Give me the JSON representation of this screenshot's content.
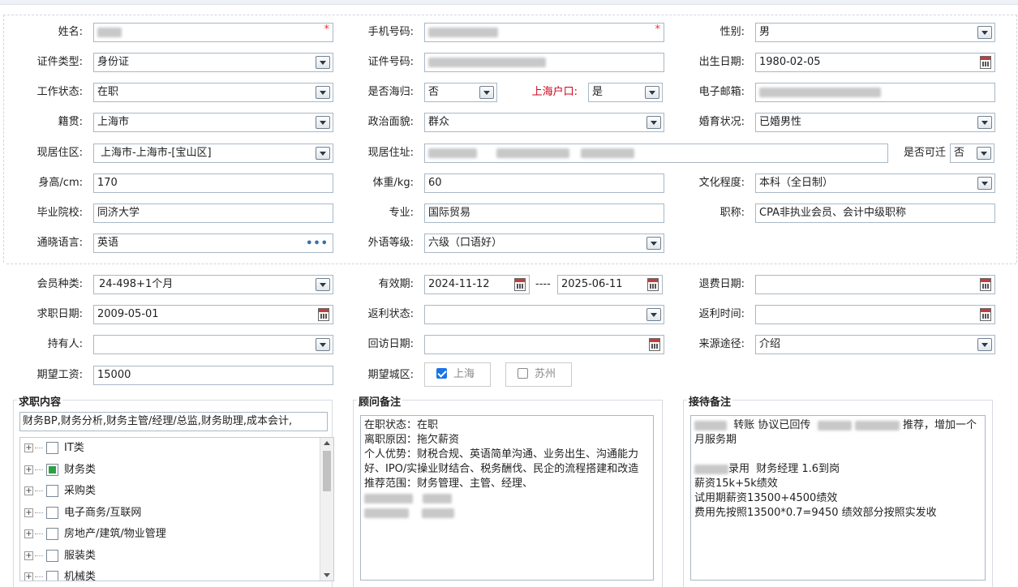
{
  "section1": {
    "name": {
      "label": "姓名:"
    },
    "phone": {
      "label": "手机号码:"
    },
    "gender": {
      "label": "性别:",
      "value": "男"
    },
    "id_type": {
      "label": "证件类型:",
      "value": "身份证"
    },
    "id_number": {
      "label": "证件号码:"
    },
    "birthday": {
      "label": "出生日期:",
      "value": "1980-02-05"
    },
    "work_status": {
      "label": "工作状态:",
      "value": "在职"
    },
    "returnee": {
      "label": "是否海归:",
      "value": "否"
    },
    "shanghai_hukou": {
      "label": "上海户口:",
      "value": "是"
    },
    "email": {
      "label": "电子邮箱:"
    },
    "native_place": {
      "label": "籍贯:",
      "value": "上海市"
    },
    "political": {
      "label": "政治面貌:",
      "value": "群众"
    },
    "marital": {
      "label": "婚育状况:",
      "value": "已婚男性"
    },
    "residence_area": {
      "label": "现居住区:",
      "value": "上海市-上海市-[宝山区]"
    },
    "residence_address": {
      "label": "现居住址:"
    },
    "relocate": {
      "label": "是否可迁",
      "value": "否"
    },
    "height": {
      "label": "身高/cm:",
      "value": "170"
    },
    "weight": {
      "label": "体重/kg:",
      "value": "60"
    },
    "education": {
      "label": "文化程度:",
      "value": "本科（全日制）"
    },
    "school": {
      "label": "毕业院校:",
      "value": "同济大学"
    },
    "major": {
      "label": "专业:",
      "value": "国际贸易"
    },
    "title": {
      "label": "职称:",
      "value": "CPA非执业会员、会计中级职称"
    },
    "languages": {
      "label": "通晓语言:",
      "value": "英语"
    },
    "language_level": {
      "label": "外语等级:",
      "value": "六级（口语好）"
    }
  },
  "section2": {
    "member_type": {
      "label": "会员种类:",
      "value": "24-498+1个月"
    },
    "validity": {
      "label": "有效期:",
      "start": "2024-11-12",
      "sep": "----",
      "end": "2025-06-11"
    },
    "refund_date": {
      "label": "退费日期:",
      "value": ""
    },
    "job_date": {
      "label": "求职日期:",
      "value": "2009-05-01"
    },
    "rebate_status": {
      "label": "返利状态:",
      "value": ""
    },
    "rebate_time": {
      "label": "返利时间:",
      "value": ""
    },
    "holder": {
      "label": "持有人:",
      "value": ""
    },
    "visit_date": {
      "label": "回访日期:",
      "value": ""
    },
    "source": {
      "label": "来源途径:",
      "value": "介绍"
    },
    "expected_salary": {
      "label": "期望工资:",
      "value": "15000"
    },
    "expected_city": {
      "label": "期望城区:",
      "options": [
        {
          "label": "上海",
          "checked": true
        },
        {
          "label": "苏州",
          "checked": false
        }
      ]
    }
  },
  "job_content": {
    "title": "求职内容",
    "summary": "财务BP,财务分析,财务主管/经理/总监,财务助理,成本会计,",
    "tree": [
      {
        "label": "IT类",
        "checked": false
      },
      {
        "label": "财务类",
        "checked": true
      },
      {
        "label": "采购类",
        "checked": false
      },
      {
        "label": "电子商务/互联网",
        "checked": false
      },
      {
        "label": "房地产/建筑/物业管理",
        "checked": false
      },
      {
        "label": "服装类",
        "checked": false
      },
      {
        "label": "机械类",
        "checked": false
      }
    ]
  },
  "advisor_notes": {
    "title": "顾问备注",
    "lines": [
      "在职状态：在职",
      "离职原因：拖欠薪资",
      "个人优势：财税合规、英语简单沟通、业务出生、沟通能力好、IPO/实操业财结合、税务酬伐、民企的流程搭建和改造",
      "推荐范围：财务管理、主管、经理、"
    ]
  },
  "reception_notes": {
    "title": "接待备注",
    "line1_a": "转账 协议已回传",
    "line1_b": "推荐，增加一个月服务期",
    "line2": "录用  财务经理 1.6到岗",
    "line3": "薪资15k+5k绩效",
    "line4": "试用期薪资13500+4500绩效",
    "line5": "费用先按照13500*0.7=9450 绩效部分按照实发收"
  },
  "icons": {
    "dropdown": "chevron-down-icon",
    "calendar": "calendar-icon",
    "more": "more-icon",
    "expand": "plus-icon"
  }
}
